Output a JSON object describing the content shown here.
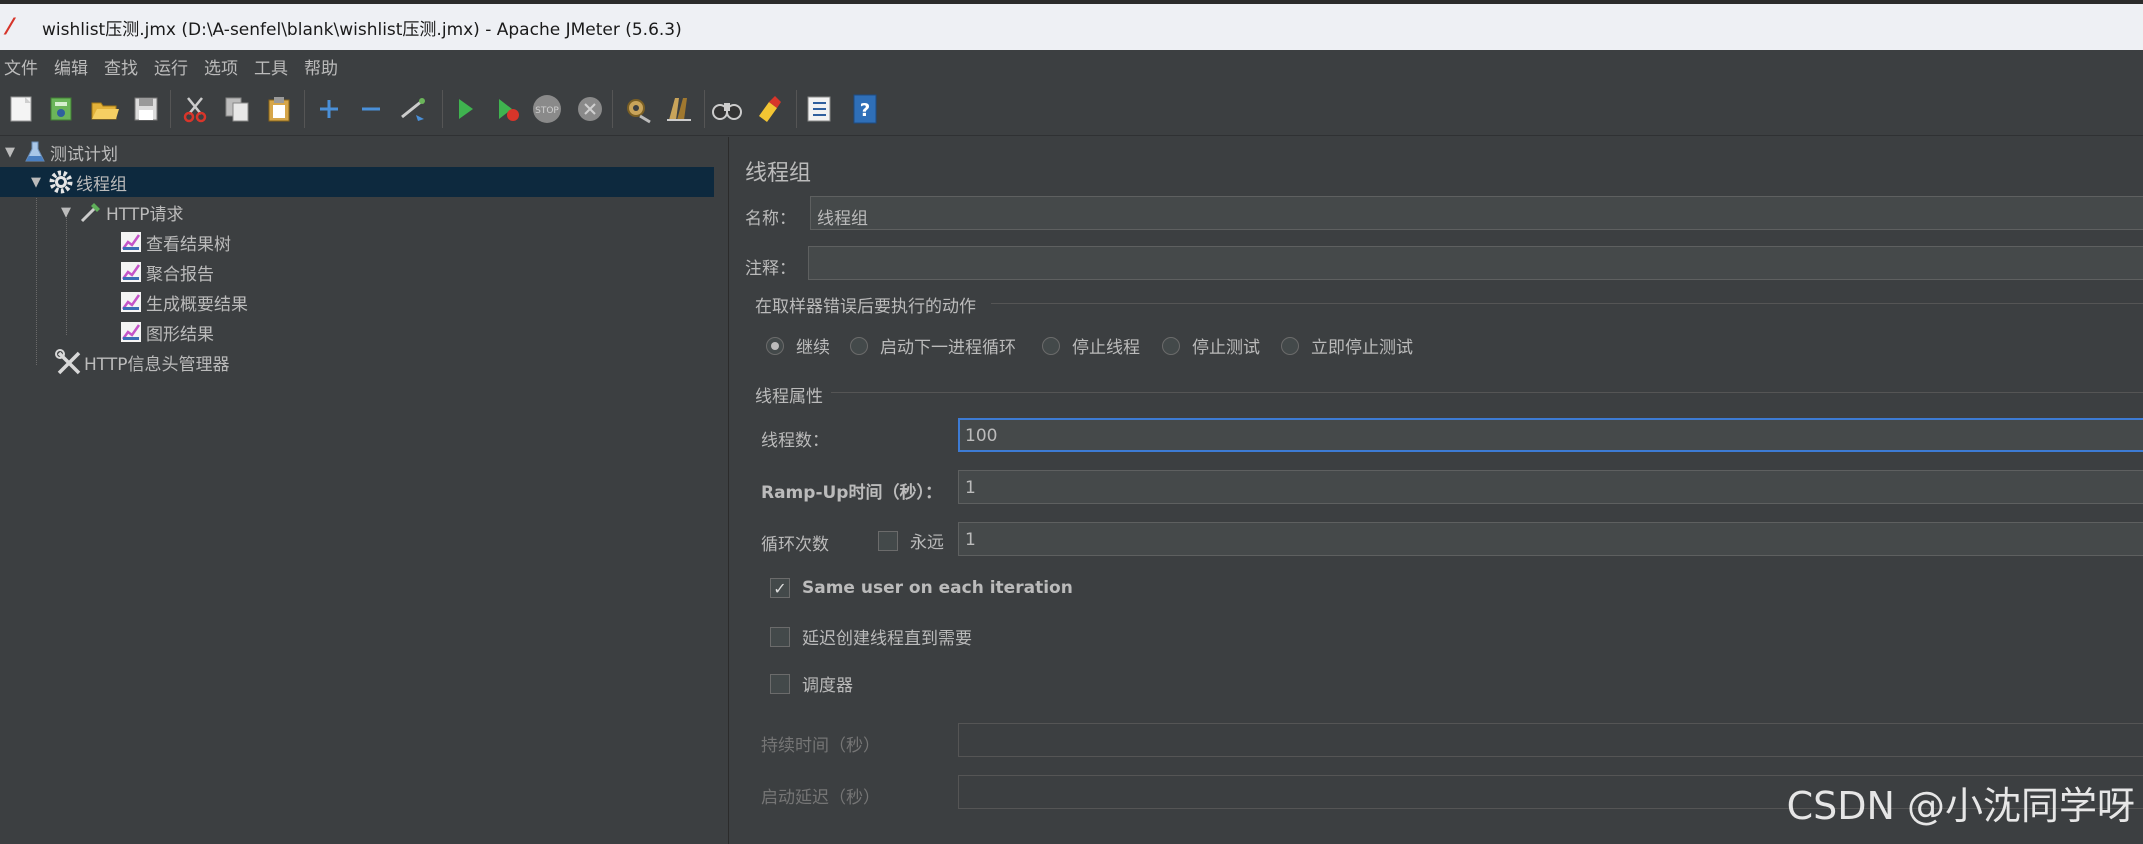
{
  "window": {
    "title": "wishlist压测.jmx (D:\\A-senfel\\blank\\wishlist压测.jmx) - Apache JMeter (5.6.3)"
  },
  "menu": [
    "文件",
    "编辑",
    "查找",
    "运行",
    "选项",
    "工具",
    "帮助"
  ],
  "toolbar": {
    "icons": [
      "new-icon",
      "templates-icon",
      "open-icon",
      "save-icon",
      "cut-icon",
      "copy-icon",
      "paste-icon",
      "expand-icon",
      "collapse-icon",
      "toggle-icon",
      "start-icon",
      "start-no-pauses-icon",
      "stop-icon",
      "shutdown-icon",
      "clear-icon",
      "clear-all-icon",
      "search-icon",
      "reset-search-icon",
      "function-helper-icon",
      "help-icon"
    ]
  },
  "tree": {
    "nodes": [
      {
        "label": "测试计划"
      },
      {
        "label": "线程组"
      },
      {
        "label": "HTTP请求"
      },
      {
        "label": "查看结果树"
      },
      {
        "label": "聚合报告"
      },
      {
        "label": "生成概要结果"
      },
      {
        "label": "图形结果"
      },
      {
        "label": "HTTP信息头管理器"
      }
    ]
  },
  "panel": {
    "heading": "线程组",
    "name_label": "名称：",
    "name_value": "线程组",
    "comment_label": "注释：",
    "comment_value": "",
    "error_group_title": "在取样器错误后要执行的动作",
    "error_options": [
      "继续",
      "启动下一进程循环",
      "停止线程",
      "停止测试",
      "立即停止测试"
    ],
    "error_selected": "继续",
    "props_group_title": "线程属性",
    "threads_label": "线程数：",
    "threads_value": "100",
    "rampup_label": "Ramp-Up时间（秒）：",
    "rampup_value": "1",
    "loop_label": "循环次数",
    "forever_label": "永远",
    "forever_checked": false,
    "loop_value": "1",
    "same_user_label": "Same user on each iteration",
    "same_user_checked": true,
    "delay_create_label": "延迟创建线程直到需要",
    "delay_create_checked": false,
    "scheduler_label": "调度器",
    "scheduler_checked": false,
    "duration_label": "持续时间（秒）",
    "startup_delay_label": "启动延迟（秒）"
  },
  "watermark": "CSDN @小沈同学呀"
}
